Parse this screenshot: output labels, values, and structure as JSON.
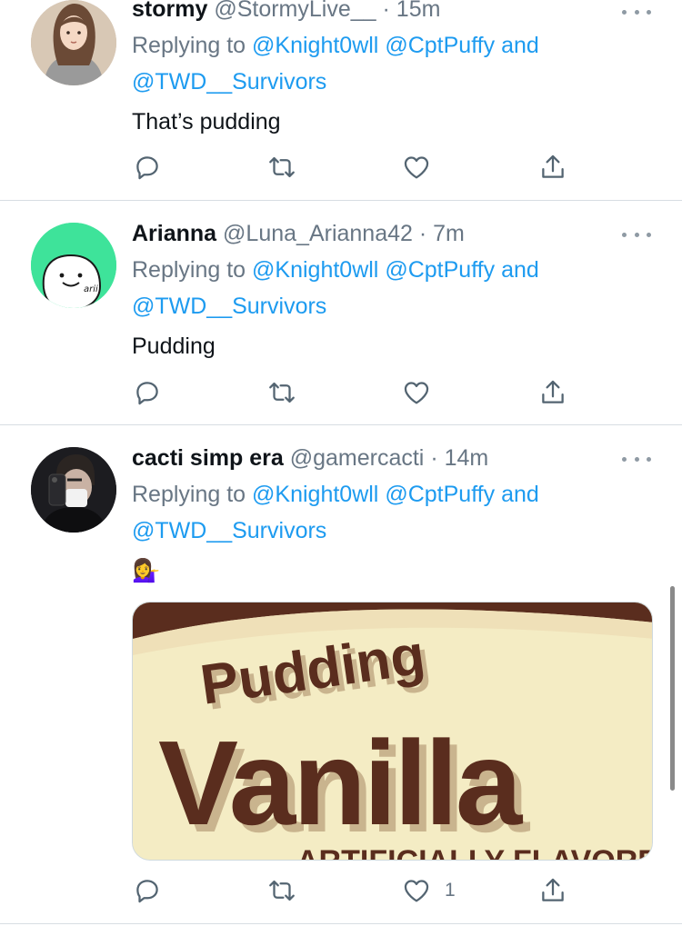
{
  "tweets": [
    {
      "name": "stormy",
      "handle": "@StormyLive__",
      "separator": "·",
      "time": "15m",
      "replying_prefix": "Replying to",
      "mention_1": "@Knight0wll",
      "mention_2": "@CptPuffy",
      "conjunction": "and",
      "mention_3": "@TWD__Survivors",
      "text": "That’s pudding"
    },
    {
      "name": "Arianna",
      "handle": "@Luna_Arianna42",
      "separator": "·",
      "time": "7m",
      "replying_prefix": "Replying to",
      "mention_1": "@Knight0wll",
      "mention_2": "@CptPuffy",
      "conjunction": "and",
      "mention_3": "@TWD__Survivors",
      "text": "Pudding",
      "avatar_label": "arii"
    },
    {
      "name": "cacti simp era",
      "handle": "@gamercacti",
      "separator": "·",
      "time": "14m",
      "replying_prefix": "Replying to",
      "mention_1": "@Knight0wll",
      "mention_2": "@CptPuffy",
      "conjunction": "and",
      "mention_3": "@TWD__Survivors",
      "text": "💁‍♀️",
      "like_count": "1",
      "media": {
        "line_1": "Pudding",
        "line_2": "Vanilla",
        "line_3": "ARTIFICIALLY FLAVORED"
      }
    }
  ],
  "icons": [
    "reply-icon",
    "retweet-icon",
    "like-icon",
    "share-icon",
    "more-icon"
  ],
  "colors": {
    "link": "#1d9bf0",
    "secondary_text": "#687684",
    "primary_text": "#0f1419",
    "divider": "#d7dde2",
    "arianna_avatar": "#3ee39a",
    "pudding_brown": "#5a2d1e",
    "pudding_cream": "#f4ecc4"
  }
}
